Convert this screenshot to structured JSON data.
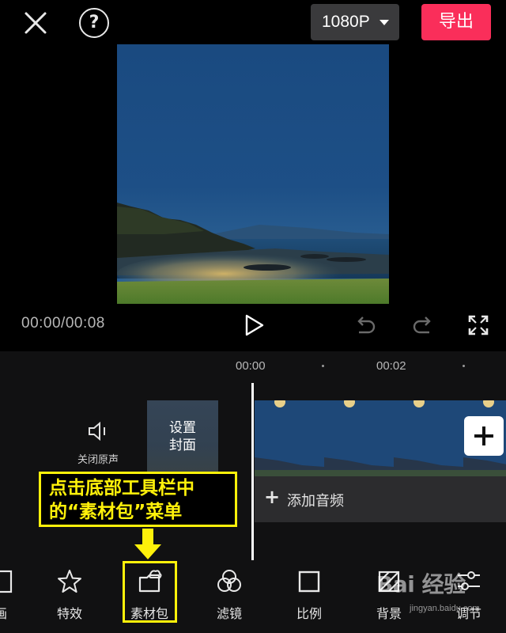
{
  "top_bar": {
    "resolution_label": "1080P",
    "export_label": "导出"
  },
  "player": {
    "time_readout": "00:00/00:08"
  },
  "timeline": {
    "ticks": [
      "00:00",
      "00:02"
    ]
  },
  "tracks": {
    "mute_label": "关闭原声",
    "cover_label_line1": "设置",
    "cover_label_line2": "封面",
    "add_audio_label": "添加音频"
  },
  "callout": {
    "line1": "点击底部工具栏中",
    "line2": "的“素材包”菜单"
  },
  "toolbar": {
    "items": [
      {
        "label": "画",
        "icon": "canvas-icon"
      },
      {
        "label": "特效",
        "icon": "effects-star-icon"
      },
      {
        "label": "素材包",
        "icon": "material-pack-icon"
      },
      {
        "label": "滤镜",
        "icon": "filter-icon"
      },
      {
        "label": "比例",
        "icon": "ratio-icon"
      },
      {
        "label": "背景",
        "icon": "background-icon"
      },
      {
        "label": "调节",
        "icon": "adjust-sliders-icon"
      }
    ]
  },
  "watermark": {
    "mark": "Bai 经验",
    "sub": "jingyan.baidu.com"
  },
  "colors": {
    "accent": "#fa2e5a",
    "callout": "#fff10a",
    "background": "#111112"
  }
}
